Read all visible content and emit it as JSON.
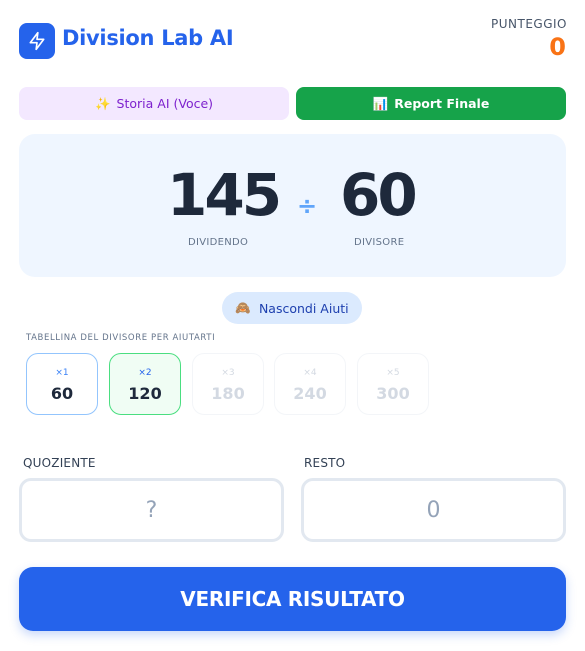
{
  "header": {
    "title": "Division Lab AI",
    "logo_icon": "lightning-icon",
    "score_label": "PUNTEGGIO",
    "score_value": "0"
  },
  "actions": {
    "story_icon": "✨",
    "story_label": "Storia AI (Voce)",
    "report_icon": "📊",
    "report_label": "Report Finale"
  },
  "problem": {
    "dividend": "145",
    "divisor": "60",
    "operator": "÷",
    "dividend_label": "DIVIDENDO",
    "divisor_label": "DIVISORE"
  },
  "hints": {
    "toggle_icon": "🙈",
    "toggle_label": "Nascondi Aiuti",
    "table_title": "TABELLINA DEL DIVISORE PER AIUTARTI",
    "tiles": [
      {
        "mult": "×1",
        "product": "60"
      },
      {
        "mult": "×2",
        "product": "120"
      },
      {
        "mult": "×3",
        "product": "180"
      },
      {
        "mult": "×4",
        "product": "240"
      },
      {
        "mult": "×5",
        "product": "300"
      }
    ]
  },
  "answer": {
    "quotient_label": "QUOZIENTE",
    "quotient_placeholder": "?",
    "quotient_value": "",
    "remainder_label": "RESTO",
    "remainder_placeholder": "0",
    "remainder_value": ""
  },
  "verify_label": "VERIFICA RISULTATO",
  "colors": {
    "primary": "#2563eb",
    "success": "#16a34a",
    "score": "#f97316",
    "story_bg": "#f3e8ff"
  }
}
